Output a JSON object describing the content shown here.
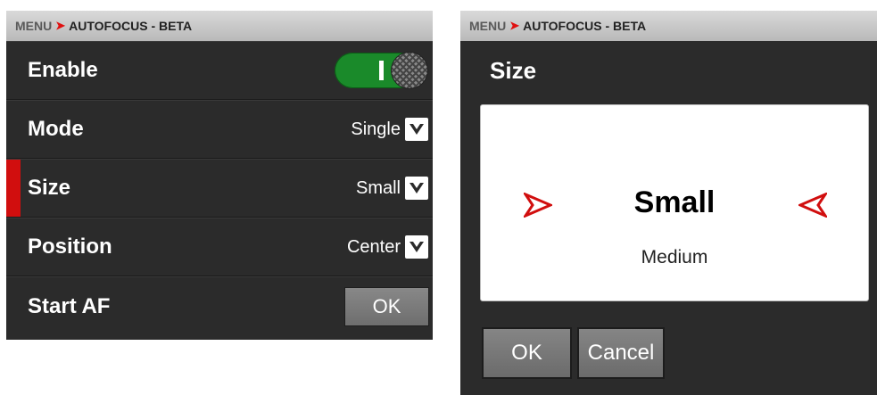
{
  "left": {
    "header": {
      "menu": "MENU",
      "separator": "➤",
      "title": "AUTOFOCUS - BETA"
    },
    "rows": [
      {
        "label": "Enable",
        "toggle_on": true
      },
      {
        "label": "Mode",
        "value": "Single"
      },
      {
        "label": "Size",
        "value": "Small"
      },
      {
        "label": "Position",
        "value": "Center"
      },
      {
        "label": "Start AF",
        "button": "OK"
      }
    ]
  },
  "right": {
    "header": {
      "menu": "MENU",
      "separator": "➤",
      "title": "AUTOFOCUS - BETA"
    },
    "title": "Size",
    "picker": {
      "selected": "Small",
      "next": "Medium"
    },
    "buttons": {
      "ok": "OK",
      "cancel": "Cancel"
    }
  },
  "colors": {
    "accent_red": "#d10e0e",
    "toggle_green": "#1a8a2a",
    "panel_bg": "#2b2b2b"
  },
  "icons": {
    "dropdown": "chevron-down-icon",
    "picker_left": "arrow-right-icon",
    "picker_right": "arrow-left-icon"
  }
}
